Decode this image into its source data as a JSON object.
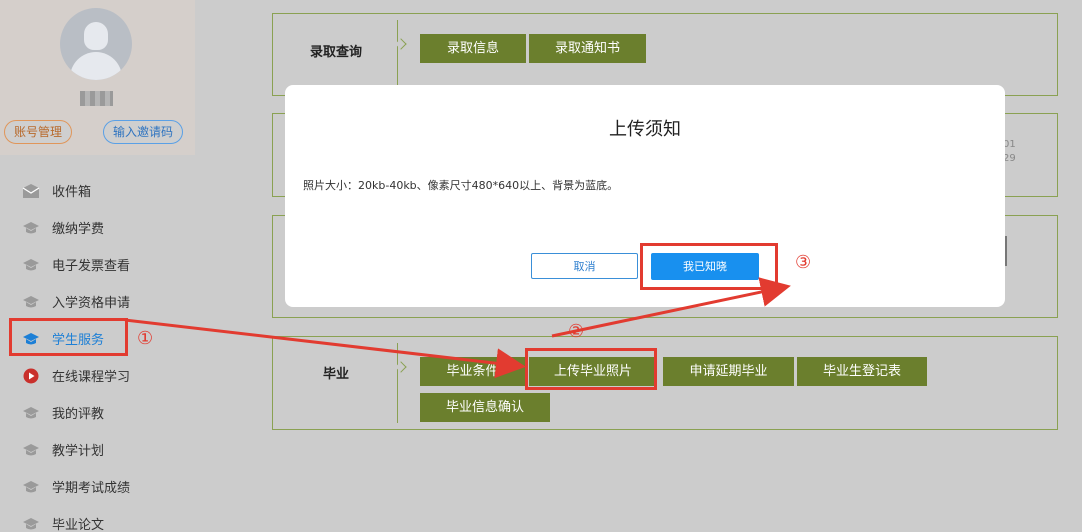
{
  "sidebar": {
    "account_label": "账号管理",
    "invite_label": "输入邀请码",
    "items": [
      {
        "label": "收件箱",
        "icon": "envelope-icon"
      },
      {
        "label": "缴纳学费",
        "icon": "graduation-cap-icon"
      },
      {
        "label": "电子发票查看",
        "icon": "graduation-cap-icon"
      },
      {
        "label": "入学资格申请",
        "icon": "graduation-cap-icon"
      },
      {
        "label": "学生服务",
        "icon": "graduation-cap-icon"
      },
      {
        "label": "在线课程学习",
        "icon": "play-circle-icon"
      },
      {
        "label": "我的评教",
        "icon": "graduation-cap-icon"
      },
      {
        "label": "教学计划",
        "icon": "graduation-cap-icon"
      },
      {
        "label": "学期考试成绩",
        "icon": "graduation-cap-icon"
      },
      {
        "label": "毕业论文",
        "icon": "graduation-cap-icon"
      }
    ]
  },
  "panels": {
    "admission": {
      "title": "录取查询",
      "buttons": [
        "录取信息",
        "录取通知书"
      ]
    },
    "panel2_partial": [
      "01",
      "29"
    ],
    "graduation": {
      "title": "毕业",
      "buttons": [
        "毕业条件",
        "上传毕业照片",
        "申请延期毕业",
        "毕业生登记表",
        "毕业信息确认"
      ]
    }
  },
  "modal": {
    "title": "上传须知",
    "body": "照片大小：20kb-40kb、像素尺寸480*640以上、背景为蓝底。",
    "cancel_label": "取消",
    "ok_label": "我已知晓"
  },
  "annotations": {
    "step1": "①",
    "step2": "②",
    "step3": "③"
  },
  "colors": {
    "accent_green": "#6b7f2d",
    "primary_blue": "#1890ef",
    "annotation_red": "#e23b30"
  }
}
